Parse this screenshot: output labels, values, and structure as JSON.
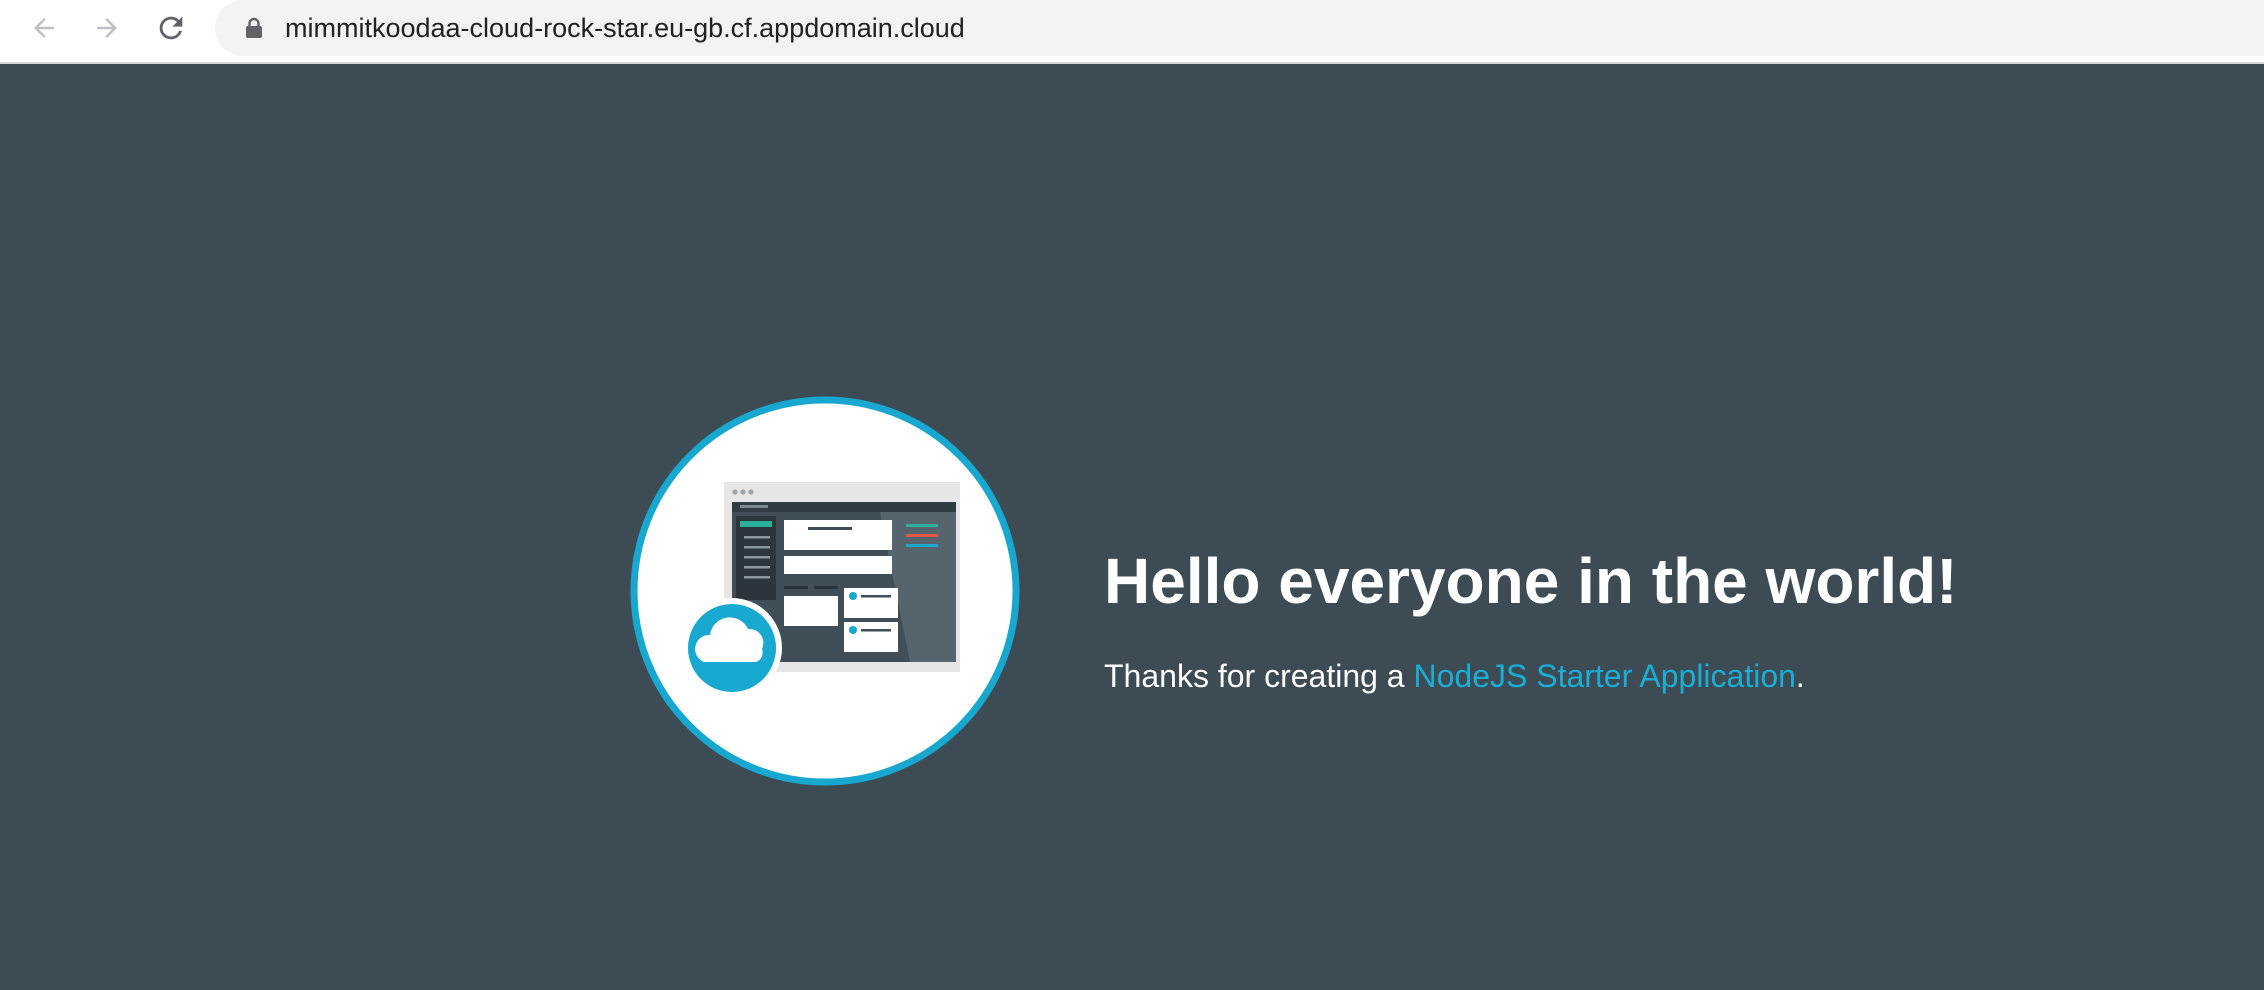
{
  "browser": {
    "url": "mimmitkoodaa-cloud-rock-star.eu-gb.cf.appdomain.cloud",
    "icons": {
      "back": "arrow-left-icon",
      "forward": "arrow-right-icon",
      "reload": "reload-icon",
      "lock": "lock-icon"
    }
  },
  "page": {
    "headline": "Hello everyone in the world!",
    "subline_prefix": "Thanks for creating a ",
    "subline_link": "NodeJS Starter Application",
    "subline_suffix": ".",
    "logo_icon": "cloud-app-illustration-icon"
  },
  "colors": {
    "background": "#3c4b54",
    "accent": "#1aaed6",
    "text": "#ffffff"
  }
}
